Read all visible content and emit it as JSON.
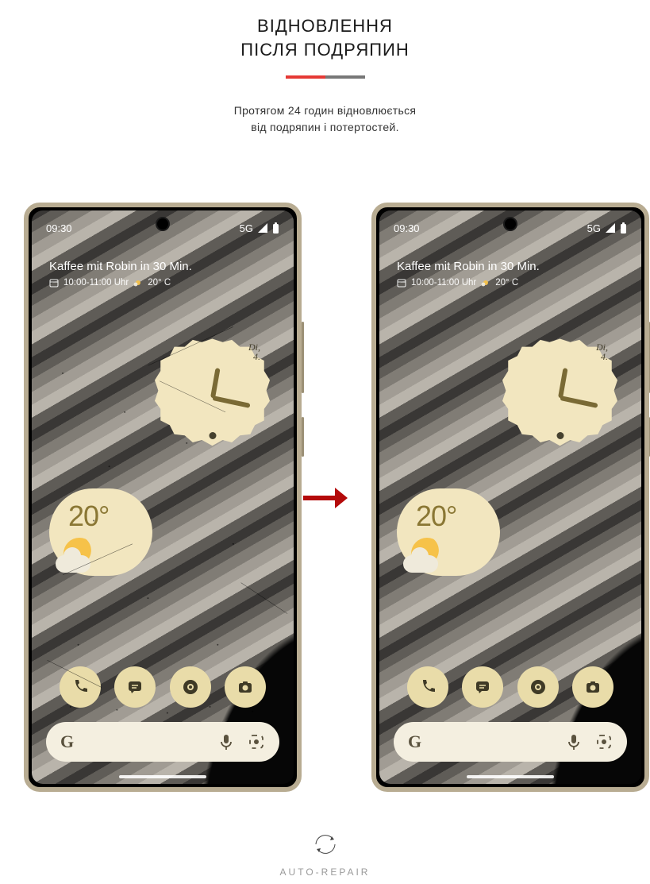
{
  "header": {
    "title_line1": "ВІДНОВЛЕННЯ",
    "title_line2": "ПІСЛЯ ПОДРЯПИН",
    "subtitle_line1": "Протягом 24 годин відновлюється",
    "subtitle_line2": "від подряпин і потертостей."
  },
  "phone": {
    "status": {
      "time": "09:30",
      "net": "5G"
    },
    "info": {
      "event": "Kaffee mit Robin in 30 Min.",
      "time": "10:00-11:00 Uhr",
      "temp": "20° C"
    },
    "clock": {
      "day1": "Di,",
      "day2": "4."
    },
    "weather": {
      "temp": "20°"
    },
    "search": {
      "g": "G"
    }
  },
  "footer": {
    "label": "AUTO-REPAIR"
  }
}
